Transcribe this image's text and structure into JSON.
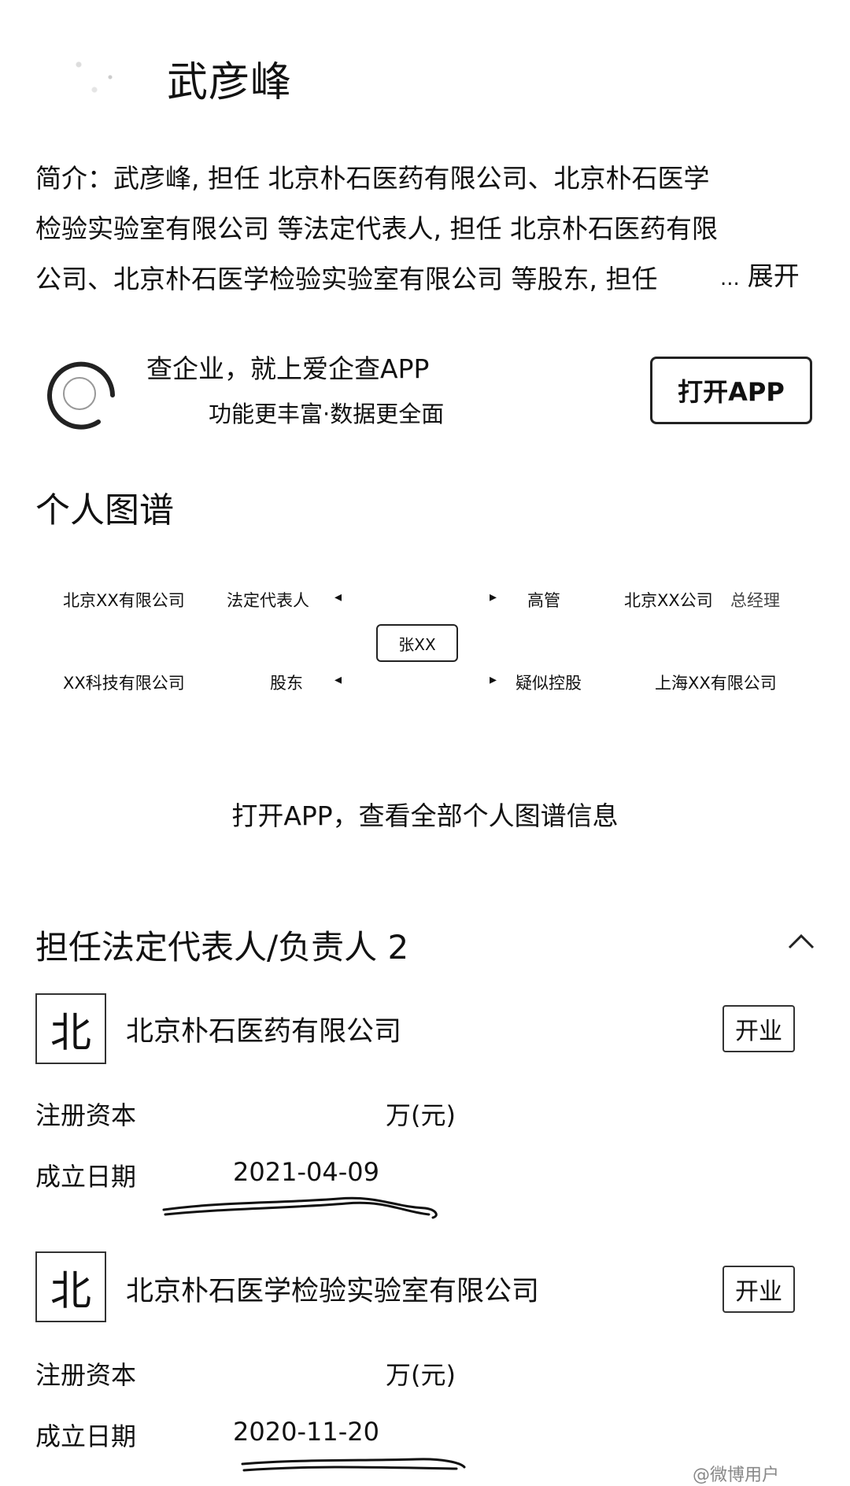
{
  "header": {
    "name": "武彦峰"
  },
  "intro": {
    "text": "简介：武彦峰, 担任 北京朴石医药有限公司、北京朴石医学检验实验室有限公司 等法定代表人, 担任 北京朴石医药有限公司、北京朴石医学检验实验室有限公司 等股东, 担任 ",
    "expand_label": "展开",
    "ellipsis": "..."
  },
  "app_banner": {
    "title": "查企业，就上爱企查APP",
    "subtitle": "功能更丰富·数据更全面",
    "button_label": "打开APP"
  },
  "graph": {
    "section_title": "个人图谱",
    "center_label": "张XX",
    "left_top_company": "北京XX有限公司",
    "left_top_role": "法定代表人",
    "left_bottom_company": "XX科技有限公司",
    "left_bottom_role": "股东",
    "right_top_role": "高管",
    "right_top_company": "北京XX公司",
    "right_top_title": "总经理",
    "right_bottom_role": "疑似控股",
    "right_bottom_company": "上海XX有限公司",
    "open_hint": "打开APP，查看全部个人图谱信息"
  },
  "legal_rep": {
    "title": "担任法定代表人/负责人 2",
    "companies": [
      {
        "logo_char": "北",
        "name": "北京朴石医药有限公司",
        "status": "开业",
        "capital_label": "注册资本",
        "capital_value": "万(元)",
        "date_label": "成立日期",
        "date_value": "2021-04-09"
      },
      {
        "logo_char": "北",
        "name": "北京朴石医学检验实验室有限公司",
        "status": "开业",
        "capital_label": "注册资本",
        "capital_value": "万(元)",
        "date_label": "成立日期",
        "date_value": "2020-11-20"
      }
    ]
  },
  "watermark": "@微博用户",
  "colors": {
    "text": "#111111",
    "border": "#222222",
    "background": "#ffffff"
  }
}
